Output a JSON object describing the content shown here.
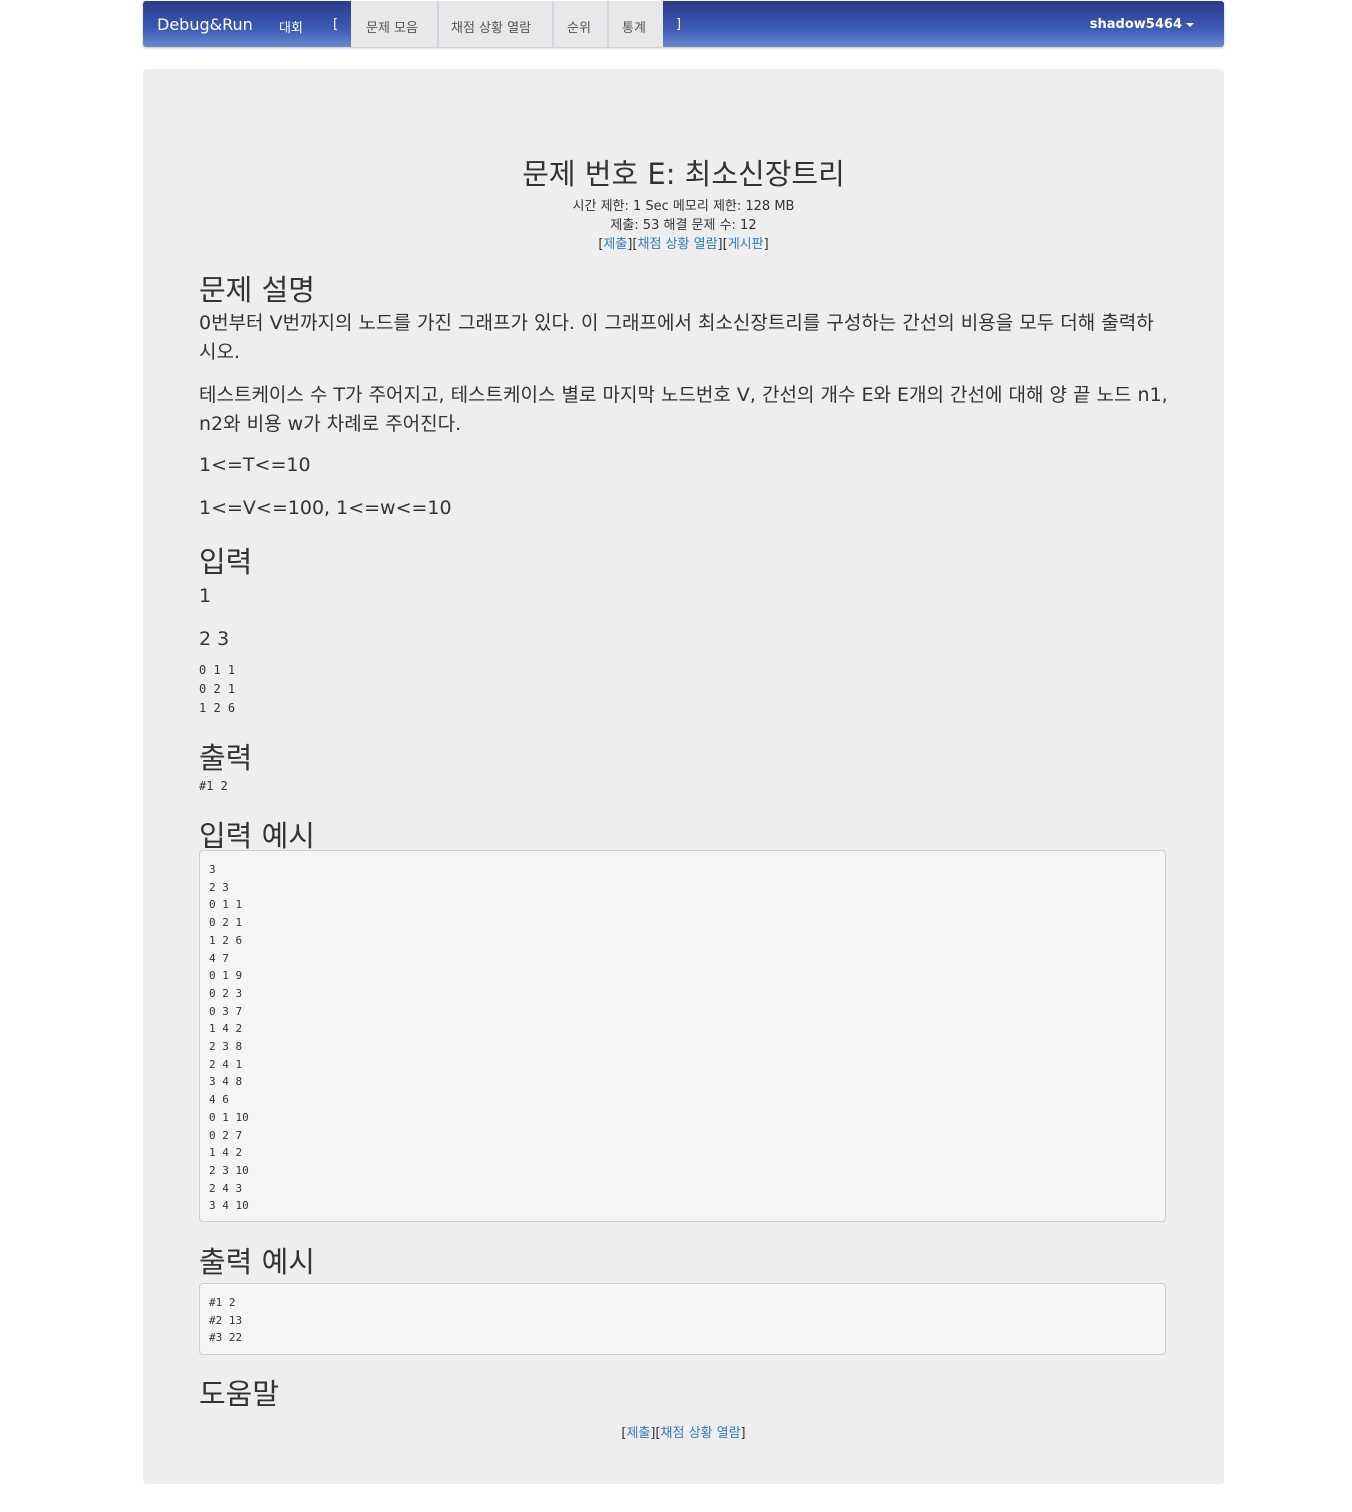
{
  "navbar": {
    "brand": "Debug&Run",
    "contest": "대회",
    "bracket_open": "[",
    "problems": "문제 모음",
    "status": "채점 상황 열람",
    "ranking": "순위",
    "stats": "통계",
    "bracket_close": "]",
    "user": "shadow5464"
  },
  "problem": {
    "title": "문제 번호 E: 최소신장트리",
    "limits": "시간 제한: 1 Sec  메모리 제한: 128 MB",
    "counts": "제출: 53  해결 문제 수: 12",
    "links": {
      "open": "[",
      "submit": "제출",
      "mid1": "][",
      "status": "채점 상황 열람",
      "mid2": "][",
      "board": "게시판",
      "close": "]"
    }
  },
  "description": {
    "heading": "문제 설명",
    "para1": "0번부터 V번까지의 노드를 가진 그래프가 있다. 이 그래프에서 최소신장트리를 구성하는 간선의 비용을 모두 더해 출력하시오.",
    "para2": "테스트케이스 수 T가 주어지고, 테스트케이스 별로 마지막 노드번호 V, 간선의 개수 E와 E개의 간선에 대해  양 끝 노드 n1, n2와 비용 w가 차례로 주어진다.",
    "para3": "1<=T<=10",
    "para4": "1<=V<=100, 1<=w<=10"
  },
  "input": {
    "heading": "입력",
    "line1": "1",
    "line2": "2 3",
    "edges": "0 1 1\n0 2 1\n1 2 6"
  },
  "output": {
    "heading": "출력",
    "text": "#1 2"
  },
  "sample_input": {
    "heading": "입력 예시",
    "text": "3\n2 3\n0 1 1\n0 2 1\n1 2 6\n4 7\n0 1 9\n0 2 3\n0 3 7\n1 4 2\n2 3 8\n2 4 1\n3 4 8\n4 6\n0 1 10\n0 2 7\n1 4 2\n2 3 10\n2 4 3\n3 4 10"
  },
  "sample_output": {
    "heading": "출력 예시",
    "text": "#1 2\n#2 13\n#3 22"
  },
  "hint": {
    "heading": "도움말"
  },
  "footer_links": {
    "open": "[",
    "submit": "제출",
    "mid": "][",
    "status": "채점 상황 열람",
    "close": "]"
  }
}
